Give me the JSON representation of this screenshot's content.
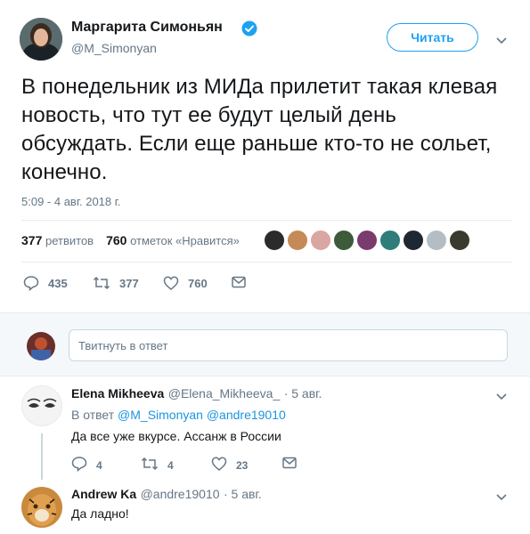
{
  "tweet": {
    "author_name": "Маргарита Симоньян",
    "author_handle": "@M_Simonyan",
    "follow_label": "Читать",
    "text": "В понедельник из МИДа прилетит такая клевая новость, что тут ее будут целый день обсуждать. Если еще раньше кто-то не сольет, конечно.",
    "timestamp": "5:09 - 4 авг. 2018 г.",
    "retweets_count": "377",
    "retweets_label": "ретвитов",
    "likes_count": "760",
    "likes_label": "отметок «Нравится»",
    "actions": {
      "reply": "435",
      "retweet": "377",
      "like": "760"
    }
  },
  "reply_box": {
    "placeholder": "Твитнуть в ответ"
  },
  "replies": [
    {
      "name": "Elena Mikheeva",
      "handle": "@Elena_Mikheeva_",
      "date": "· 5 авг.",
      "in_reply_prefix": "В ответ",
      "in_reply_to_1": "@M_Simonyan",
      "in_reply_to_2": "@andre19010",
      "text": "Да все уже вкурсе. Ассанж в России",
      "reply_count": "4",
      "retweet_count": "4",
      "like_count": "23"
    },
    {
      "name": "Andrew Ka",
      "handle": "@andre19010",
      "date": "· 5 авг.",
      "text": "Да ладно!"
    }
  ],
  "colors": {
    "accent": "#1da1f2",
    "verified": "#1da1f2",
    "muted": "#657786"
  }
}
